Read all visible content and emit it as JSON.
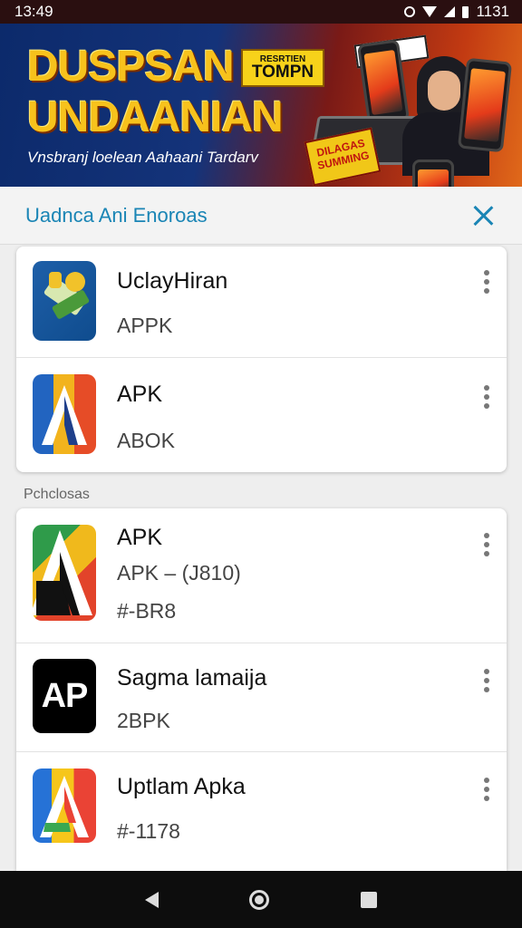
{
  "status_bar": {
    "time": "13:49",
    "right_time": "1131"
  },
  "banner": {
    "title_line1": "DUSPSAN",
    "title_line2": "UNDAANIAN",
    "tag_small": "RESRTIEN",
    "tag_main": "TOMPN",
    "subtitle": "Vnsbranj loelean Aahaani Tardarv",
    "promo": "DILAGAS SUMMING"
  },
  "header": {
    "title": "Uadnca Ani Enoroas"
  },
  "section_label": "Pchclosas",
  "top_apps": [
    {
      "title": "UclayHiran",
      "subtitle": "APPK",
      "icon": "blue-ribbon-icon"
    },
    {
      "title": "APK",
      "subtitle": "ABOK",
      "icon": "a-letter-icon"
    }
  ],
  "other_apps": [
    {
      "title": "APK",
      "subtitle": "APK – (J810)",
      "extra": "#-BR8",
      "icon": "multicolor-a-icon"
    },
    {
      "title": "Sagma lamaija",
      "subtitle": "2BPK",
      "icon": "ap-logo-icon"
    },
    {
      "title": "Uptlam Apka",
      "subtitle": "#-1178",
      "icon": "google-a-icon"
    }
  ],
  "colors": {
    "accent": "#1a85b5",
    "status_bar": "#2a0f10",
    "nav_bar": "#0d0d0d"
  }
}
